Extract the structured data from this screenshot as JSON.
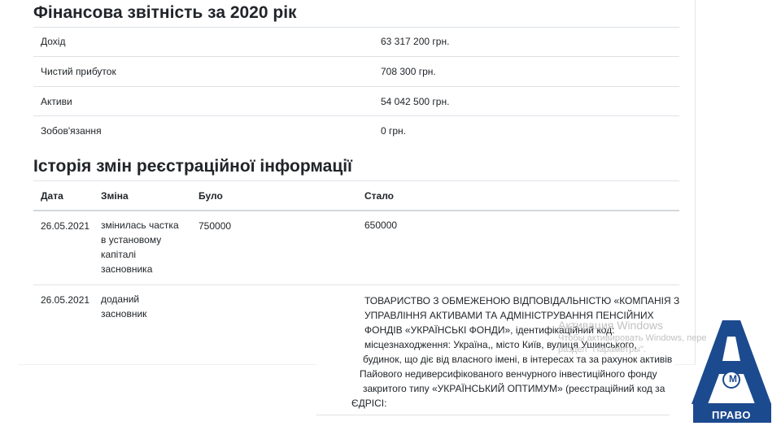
{
  "financial": {
    "title": "Фінансова звітність за 2020 рік",
    "rows": [
      {
        "label": "Дохід",
        "value": "63 317 200 грн."
      },
      {
        "label": "Чистий прибуток",
        "value": "708 300 грн."
      },
      {
        "label": "Активи",
        "value": "54 042 500 грн."
      },
      {
        "label": "Зобов'язання",
        "value": "0 грн."
      }
    ]
  },
  "history": {
    "title": "Історія змін реєстраційної інформації",
    "columns": [
      "Дата",
      "Зміна",
      "Було",
      "Стало"
    ],
    "rows": [
      {
        "date": "26.05.2021",
        "change_lines": [
          "змінилась частка",
          "в установому",
          "капіталі",
          "засновника"
        ],
        "before": "750000",
        "after_lines": [
          "650000"
        ]
      },
      {
        "date": "26.05.2021",
        "change_lines": [
          "доданий",
          "засновник"
        ],
        "before": "",
        "after_lines": [
          "ТОВАРИСТВО З ОБМЕЖЕНОЮ ВІДПОВІДАЛЬНІСТЮ «КОМПАНІЯ З",
          "УПРАВЛІННЯ АКТИВАМИ ТА АДМІНІСТРУВАННЯ ПЕНСІЙНИХ",
          "ФОНДІВ «УКРАЇНСЬКІ ФОНДИ», ідентифікаційний код:",
          "місцезнаходження: Україна,, місто Київ, вулиця Ушинського,",
          "будинок, що діє від власного імені, в інтересах та за рахунок активів",
          "Пайового недиверсифікованого венчурного інвестиційного фонду",
          "закритого типу «УКРАЇНСЬКИЙ ОПТИМУМ» (реєстраційний код за",
          "ЄДРІСІ:"
        ]
      }
    ]
  },
  "watermark": {
    "line1": "Активация Windows",
    "line2": "Чтобы активировать Windows, пере",
    "line3": "раздел \"Параметры\"."
  },
  "logo": {
    "text": "ПРАВО",
    "monogram": "М",
    "color": "#1c4a8f"
  }
}
